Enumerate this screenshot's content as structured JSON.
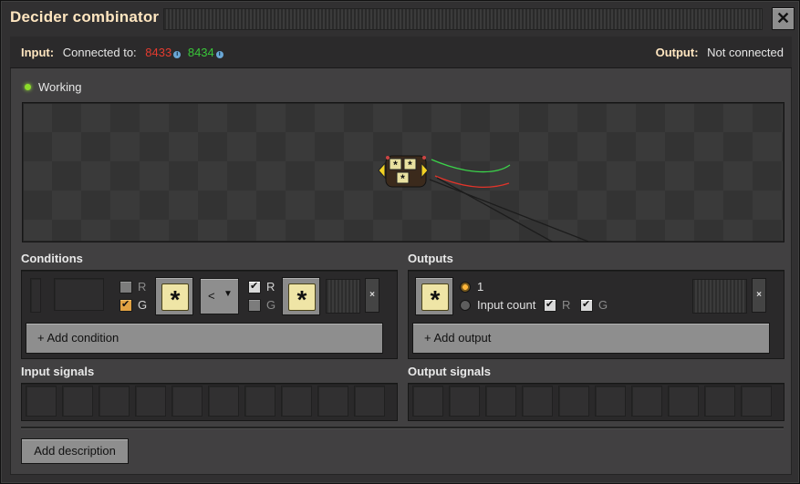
{
  "window": {
    "title": "Decider combinator",
    "close_symbol": "✕"
  },
  "connections": {
    "input_label": "Input:",
    "connected_to": "Connected to:",
    "red_network": "8433",
    "green_network": "8434",
    "output_label": "Output:",
    "output_status": "Not connected"
  },
  "status": {
    "text": "Working",
    "color": "#8cdc2a"
  },
  "conditions": {
    "title": "Conditions",
    "left_wires": {
      "R": {
        "label": "R",
        "checked": false
      },
      "G": {
        "label": "G",
        "checked": true
      }
    },
    "left_signal": "everything-icon",
    "comparator": "<",
    "right_wires": {
      "R": {
        "label": "R",
        "checked": true
      },
      "G": {
        "label": "G",
        "checked": false
      }
    },
    "right_signal": "everything-icon",
    "remove_symbol": "×",
    "add_button": "+ Add condition"
  },
  "outputs": {
    "title": "Outputs",
    "signal": "everything-icon",
    "option_value": "1",
    "option_input_count": "Input count",
    "wire_R": "R",
    "wire_G": "G",
    "remove_symbol": "×",
    "add_button": "+ Add output"
  },
  "input_signals": {
    "title": "Input signals"
  },
  "output_signals": {
    "title": "Output signals"
  },
  "description_button": "Add description",
  "colors": {
    "accent": "#e2a242",
    "red_wire": "#e33b2f",
    "green_wire": "#39c539",
    "title": "#ffe6c0"
  }
}
